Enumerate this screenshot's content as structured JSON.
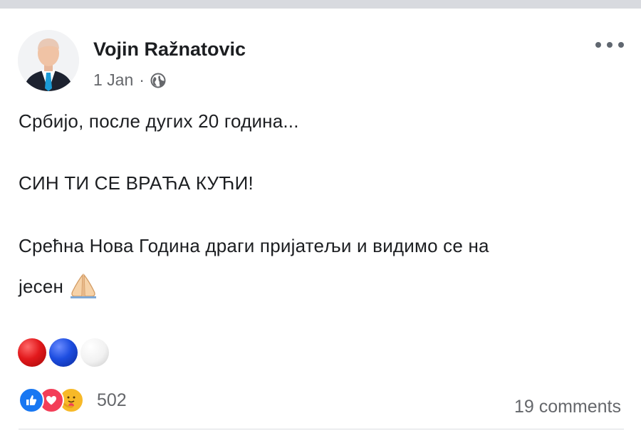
{
  "post": {
    "author": "Vojin Ražnatovic",
    "date": "1 Jan",
    "separator": "·",
    "privacy_icon": "globe-icon",
    "lines": [
      "Србијо, после дугих 20 година...",
      "СИН ТИ СЕ ВРАЋА КУЋИ!",
      "Срећна Нова Година драги пријатељи и видимо се на",
      "јесен"
    ],
    "emoji": "folded-hands-icon",
    "flag_dots": [
      "red",
      "blue",
      "white"
    ]
  },
  "footer": {
    "reactions": [
      "like-icon",
      "love-icon",
      "care-icon"
    ],
    "reaction_count": "502",
    "comments": "19 comments"
  },
  "colors": {
    "text": "#1c1e21",
    "secondary": "#65676b",
    "like": "#1877f2",
    "love": "#f33e58",
    "care": "#f7b928"
  }
}
